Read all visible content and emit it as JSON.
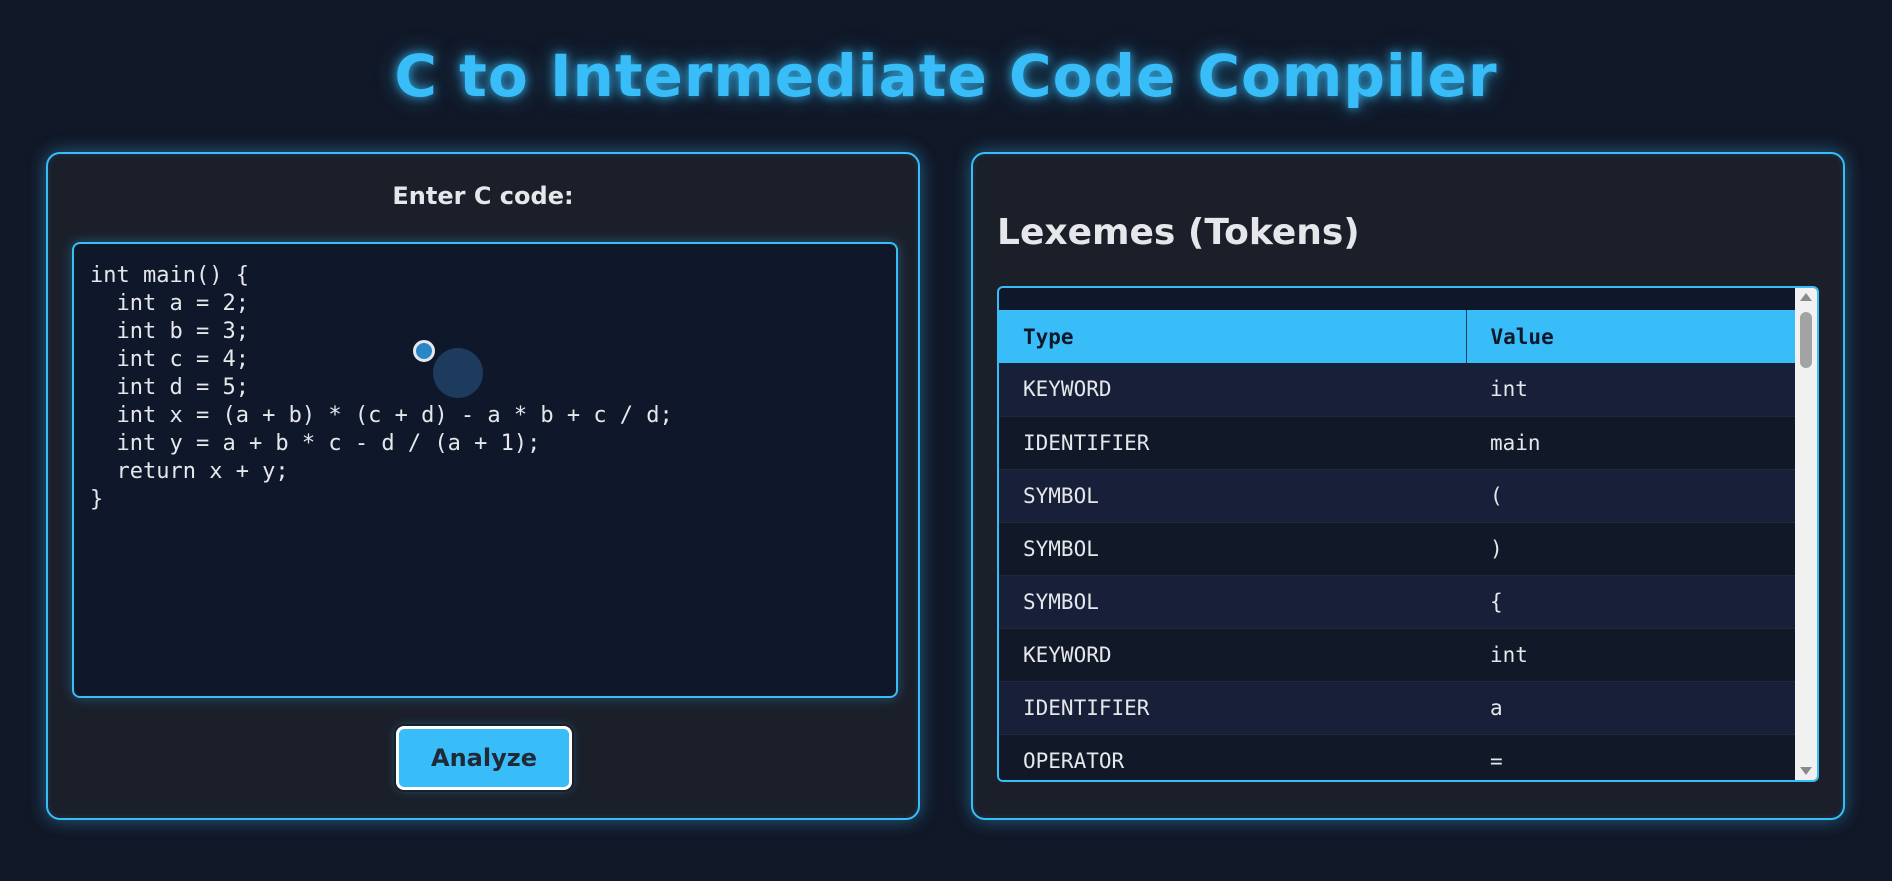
{
  "title": "C to Intermediate Code Compiler",
  "editor": {
    "label": "Enter C code:",
    "code": "int main() {\n  int a = 2;\n  int b = 3;\n  int c = 4;\n  int d = 5;\n  int x = (a + b) * (c + d) - a * b + c / d;\n  int y = a + b * c - d / (a + 1);\n  return x + y;\n}",
    "analyze_label": "Analyze"
  },
  "tokens": {
    "heading": "Lexemes (Tokens)",
    "columns": {
      "type": "Type",
      "value": "Value"
    },
    "rows": [
      {
        "type": "KEYWORD",
        "value": "int"
      },
      {
        "type": "IDENTIFIER",
        "value": "main"
      },
      {
        "type": "SYMBOL",
        "value": "("
      },
      {
        "type": "SYMBOL",
        "value": ")"
      },
      {
        "type": "SYMBOL",
        "value": "{"
      },
      {
        "type": "KEYWORD",
        "value": "int"
      },
      {
        "type": "IDENTIFIER",
        "value": "a"
      },
      {
        "type": "OPERATOR",
        "value": "="
      }
    ]
  },
  "colors": {
    "accent": "#38bdf8",
    "background": "#111827",
    "panel": "#1b1f2a",
    "row_odd": "#172038",
    "row_even": "#111827"
  },
  "icons": {
    "scroll_up": "chevron-up-icon",
    "scroll_down": "chevron-down-icon",
    "cursor": "mouse-cursor-icon"
  }
}
